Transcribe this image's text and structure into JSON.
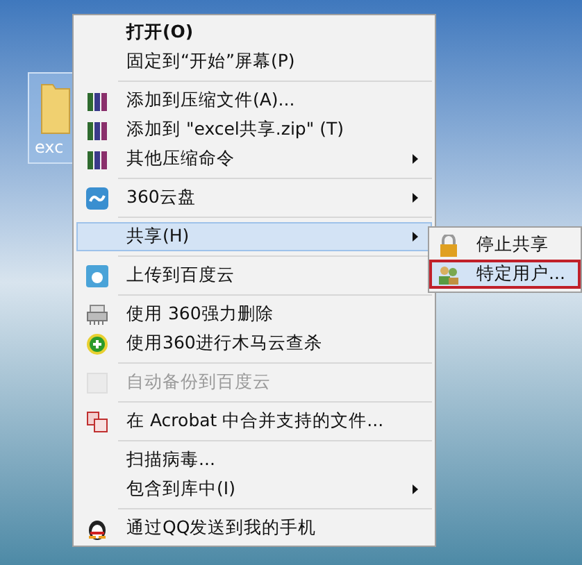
{
  "desktop": {
    "icon_label": "exc"
  },
  "menu": {
    "items": [
      {
        "kind": "item",
        "label": "打开(O)",
        "default": true,
        "disabled": false,
        "selected": false,
        "submenu": false
      },
      {
        "kind": "item",
        "label": "固定到“开始”屏幕(P)",
        "default": false,
        "disabled": false,
        "selected": false,
        "submenu": false
      },
      {
        "kind": "separator"
      },
      {
        "kind": "item",
        "label": "添加到压缩文件(A)...",
        "default": false,
        "disabled": false,
        "selected": false,
        "submenu": false
      },
      {
        "kind": "item",
        "label": "添加到 \"excel共享.zip\" (T)",
        "default": false,
        "disabled": false,
        "selected": false,
        "submenu": false
      },
      {
        "kind": "item",
        "label": "其他压缩命令",
        "default": false,
        "disabled": false,
        "selected": false,
        "submenu": true
      },
      {
        "kind": "separator"
      },
      {
        "kind": "item",
        "label": "360云盘",
        "default": false,
        "disabled": false,
        "selected": false,
        "submenu": true
      },
      {
        "kind": "separator"
      },
      {
        "kind": "item",
        "label": "共享(H)",
        "default": false,
        "disabled": false,
        "selected": true,
        "submenu": true
      },
      {
        "kind": "separator"
      },
      {
        "kind": "item",
        "label": "上传到百度云",
        "default": false,
        "disabled": false,
        "selected": false,
        "submenu": false
      },
      {
        "kind": "separator"
      },
      {
        "kind": "item",
        "label": "使用 360强力删除",
        "default": false,
        "disabled": false,
        "selected": false,
        "submenu": false
      },
      {
        "kind": "item",
        "label": "使用360进行木马云查杀",
        "default": false,
        "disabled": false,
        "selected": false,
        "submenu": false
      },
      {
        "kind": "separator"
      },
      {
        "kind": "item",
        "label": "自动备份到百度云",
        "default": false,
        "disabled": true,
        "selected": false,
        "submenu": false
      },
      {
        "kind": "separator"
      },
      {
        "kind": "item",
        "label": "在 Acrobat 中合并支持的文件...",
        "default": false,
        "disabled": false,
        "selected": false,
        "submenu": false
      },
      {
        "kind": "separator"
      },
      {
        "kind": "item",
        "label": "扫描病毒...",
        "default": false,
        "disabled": false,
        "selected": false,
        "submenu": false
      },
      {
        "kind": "item",
        "label": "包含到库中(I)",
        "default": false,
        "disabled": false,
        "selected": false,
        "submenu": true
      },
      {
        "kind": "separator"
      },
      {
        "kind": "item",
        "label": "通过QQ发送到我的手机",
        "default": false,
        "disabled": false,
        "selected": false,
        "submenu": false
      }
    ]
  },
  "submenu": {
    "items": [
      {
        "label": "停止共享",
        "selected": false,
        "outlined": false
      },
      {
        "label": "特定用户...",
        "selected": true,
        "outlined": true
      }
    ]
  }
}
